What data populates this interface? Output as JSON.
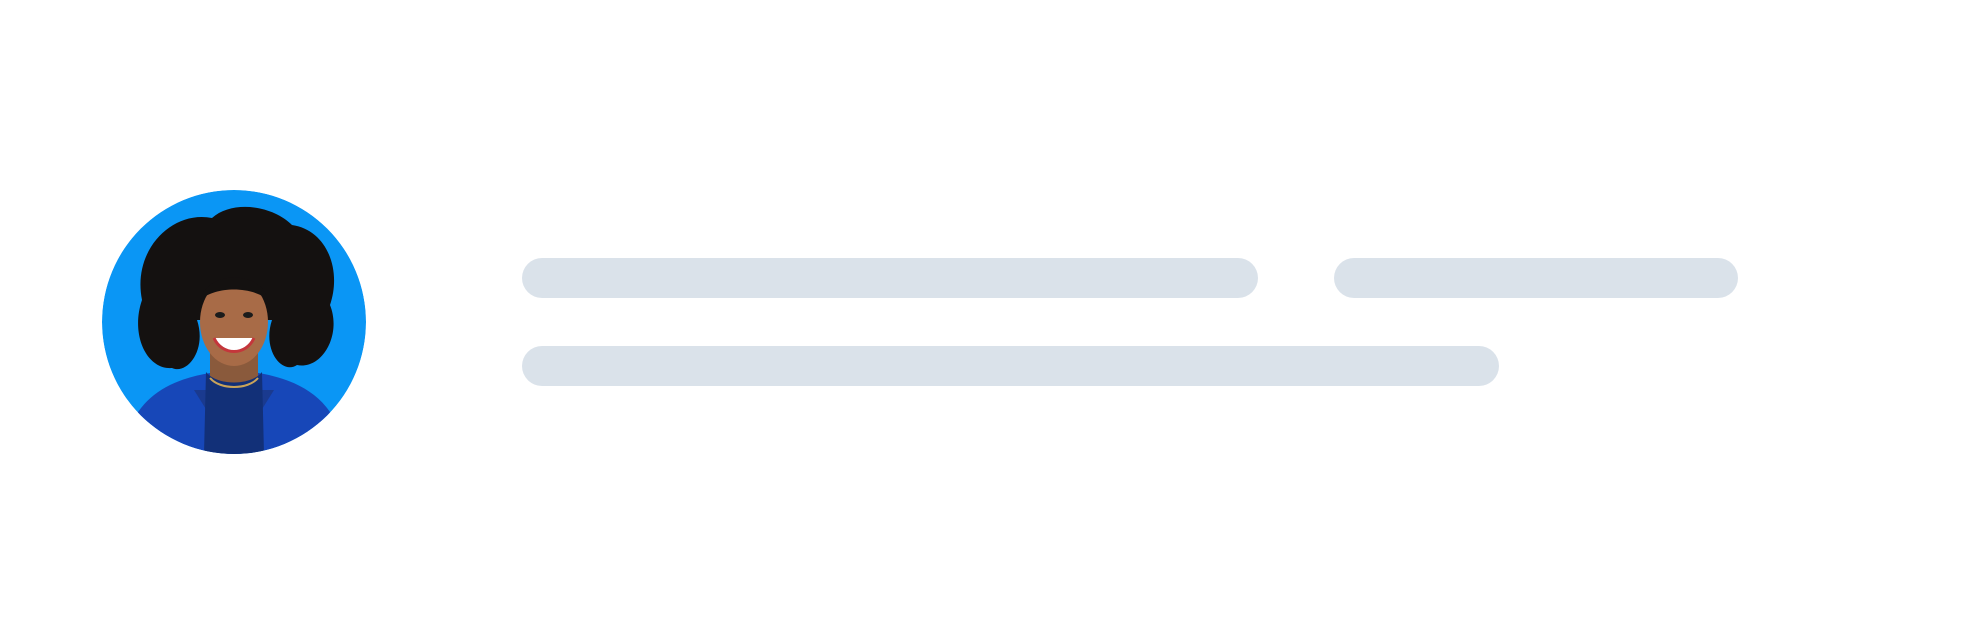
{
  "profile": {
    "avatar_icon": "person-photo",
    "avatar_background": "#0a96f5"
  },
  "skeleton": {
    "color": "#dae2ea",
    "lines": [
      {
        "name": "skeleton-line-name"
      },
      {
        "name": "skeleton-line-meta"
      },
      {
        "name": "skeleton-line-description"
      }
    ]
  }
}
